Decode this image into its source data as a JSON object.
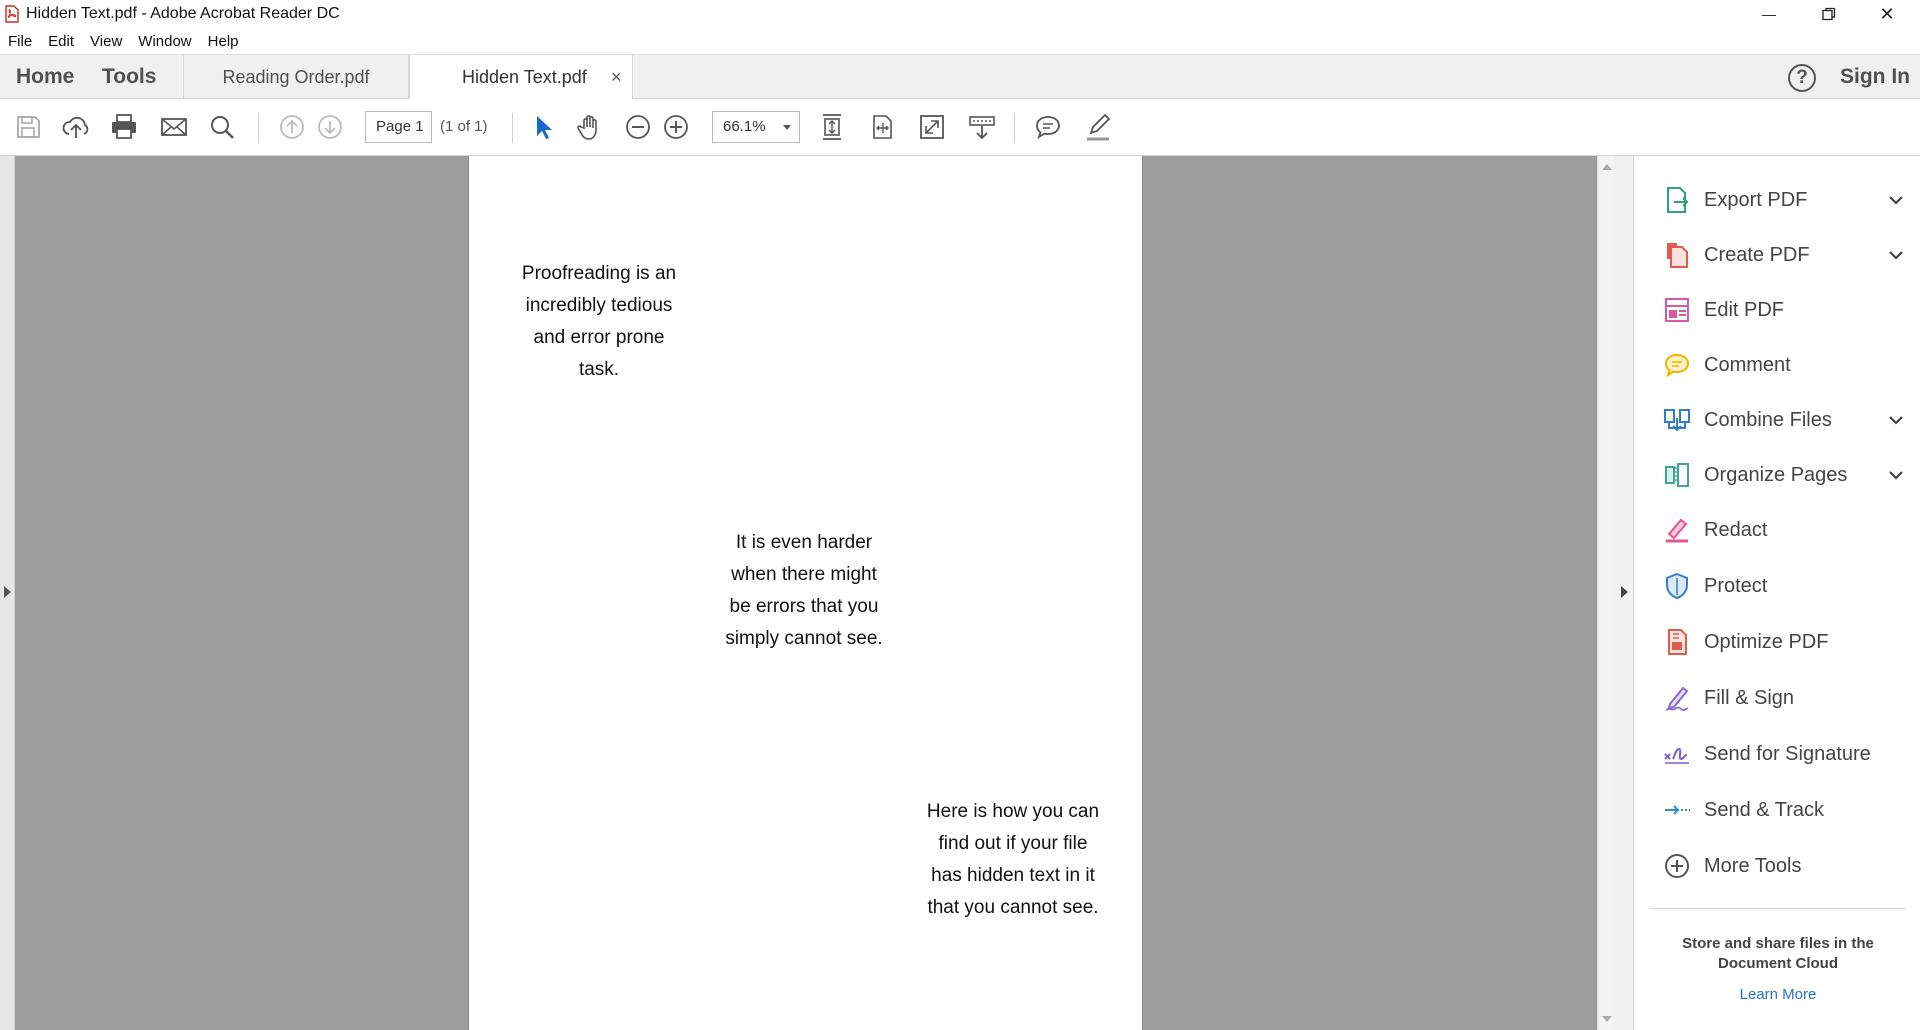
{
  "window": {
    "title": "Hidden Text.pdf - Adobe Acrobat Reader DC",
    "minimize_glyph": "—",
    "close_glyph": "✕"
  },
  "menu": [
    "File",
    "Edit",
    "View",
    "Window",
    "Help"
  ],
  "tabs": {
    "home": "Home",
    "tools": "Tools",
    "documents": [
      {
        "label": "Reading Order.pdf",
        "active": false
      },
      {
        "label": "Hidden Text.pdf",
        "active": true
      }
    ],
    "close_glyph": "×",
    "help_glyph": "?",
    "sign_in": "Sign In"
  },
  "toolbar": {
    "page_label": "Page 1",
    "page_count": "(1 of 1)",
    "zoom": "66.1%",
    "icons": [
      "save-icon",
      "upload-icon",
      "print-icon",
      "email-icon",
      "search-icon",
      "prev-page-icon",
      "next-page-icon",
      "select-cursor-icon",
      "hand-icon",
      "zoom-out-icon",
      "zoom-in-icon",
      "fit-page-icon",
      "fit-width-icon",
      "full-screen-icon",
      "read-mode-icon",
      "comment-icon",
      "highlight-pen-icon"
    ]
  },
  "document": {
    "paragraphs": [
      "Proofreading is an\nincredibly tedious\nand error prone\ntask.",
      "It is even harder\nwhen there might\nbe errors that you\nsimply cannot see.",
      "Here is how you can\nfind out if your file\nhas hidden text in it\nthat you cannot see."
    ]
  },
  "right_panel": {
    "tools": [
      {
        "label": "Export PDF",
        "icon": "export-pdf-icon",
        "color": "#2fa37b",
        "has_chevron": true
      },
      {
        "label": "Create PDF",
        "icon": "create-pdf-icon",
        "color": "#e05a4e",
        "has_chevron": true
      },
      {
        "label": "Edit PDF",
        "icon": "edit-pdf-icon",
        "color": "#d45aa3",
        "has_chevron": false
      },
      {
        "label": "Comment",
        "icon": "comment-icon",
        "color": "#f2b400",
        "has_chevron": false
      },
      {
        "label": "Combine Files",
        "icon": "combine-files-icon",
        "color": "#2d7fc7",
        "has_chevron": true
      },
      {
        "label": "Organize Pages",
        "icon": "organize-pages-icon",
        "color": "#3fa79a",
        "has_chevron": true
      },
      {
        "label": "Redact",
        "icon": "redact-icon",
        "color": "#e5548f",
        "has_chevron": false
      },
      {
        "label": "Protect",
        "icon": "protect-icon",
        "color": "#3b7ec7",
        "has_chevron": false
      },
      {
        "label": "Optimize PDF",
        "icon": "optimize-pdf-icon",
        "color": "#e05a4e",
        "has_chevron": false
      },
      {
        "label": "Fill & Sign",
        "icon": "fill-sign-icon",
        "color": "#8a6ad6",
        "has_chevron": false
      },
      {
        "label": "Send for Signature",
        "icon": "send-signature-icon",
        "color": "#7b5fd1",
        "has_chevron": false
      },
      {
        "label": "Send & Track",
        "icon": "send-track-icon",
        "color": "#2d8fd0",
        "has_chevron": false
      },
      {
        "label": "More Tools",
        "icon": "more-tools-icon",
        "color": "#555555",
        "has_chevron": false
      }
    ],
    "cloud_text": "Store and share files in the\nDocument Cloud",
    "learn_more": "Learn More"
  }
}
